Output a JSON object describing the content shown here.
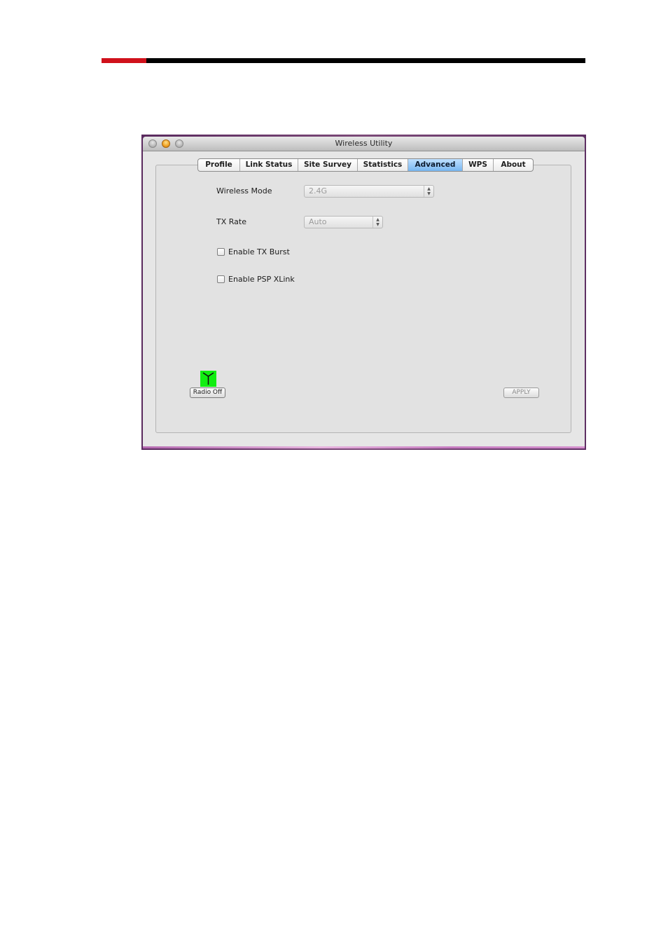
{
  "window": {
    "title": "Wireless Utility"
  },
  "tabs": [
    {
      "label": "Profile",
      "active": false
    },
    {
      "label": "Link Status",
      "active": false
    },
    {
      "label": "Site Survey",
      "active": false
    },
    {
      "label": "Statistics",
      "active": false
    },
    {
      "label": "Advanced",
      "active": true
    },
    {
      "label": "WPS",
      "active": false
    },
    {
      "label": "About",
      "active": false
    }
  ],
  "settings": {
    "wireless_mode_label": "Wireless Mode",
    "wireless_mode_value": "2.4G",
    "tx_rate_label": "TX Rate",
    "tx_rate_value": "Auto",
    "tx_burst_label": "Enable TX Burst",
    "tx_burst_checked": false,
    "psp_xlink_label": "Enable PSP XLink",
    "psp_xlink_checked": false
  },
  "buttons": {
    "radio_off": "Radio Off",
    "apply": "APPLY"
  },
  "colors": {
    "active_tab": "#78b6f1",
    "radio_indicator": "#11ee11",
    "rule_red": "#d0111b",
    "rule_black": "#000000"
  },
  "icons": {
    "radio": "antenna-icon",
    "stepper": "up-down-arrows-icon"
  }
}
